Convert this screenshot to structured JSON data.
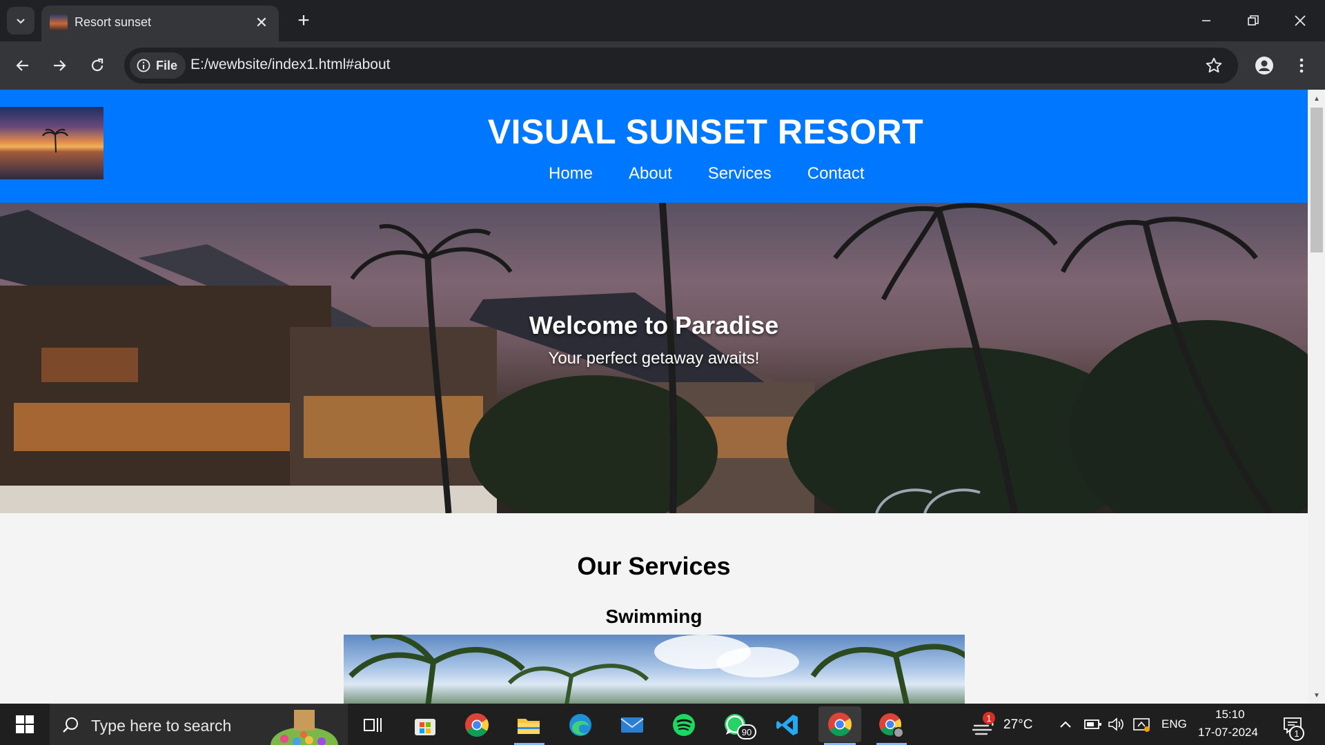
{
  "browser": {
    "tab_title": "Resort sunset",
    "url_chip": "File",
    "url": "E:/wewbsite/index1.html#about"
  },
  "site": {
    "title": "VISUAL SUNSET RESORT",
    "nav": [
      "Home",
      "About",
      "Services",
      "Contact"
    ],
    "hero_title": "Welcome to Paradise",
    "hero_subtitle": "Your perfect getaway awaits!",
    "services_heading": "Our Services",
    "first_service": "Swimming"
  },
  "taskbar": {
    "search_placeholder": "Type here to search",
    "whatsapp_badge": "90",
    "weather_badge": "1",
    "temperature": "27°C",
    "language": "ENG",
    "time": "15:10",
    "date": "17-07-2024",
    "notification_count": "1",
    "apps": [
      "task-view-icon",
      "microsoft-store-icon",
      "chrome-icon",
      "file-explorer-icon",
      "edge-icon",
      "mail-icon",
      "spotify-icon",
      "whatsapp-icon",
      "vscode-icon",
      "chrome-icon",
      "chrome-profile-icon"
    ]
  },
  "colors": {
    "header_blue": "#0077ff",
    "page_bg": "#f4f4f4",
    "browser_dark": "#202124",
    "toolbar": "#35363a"
  }
}
